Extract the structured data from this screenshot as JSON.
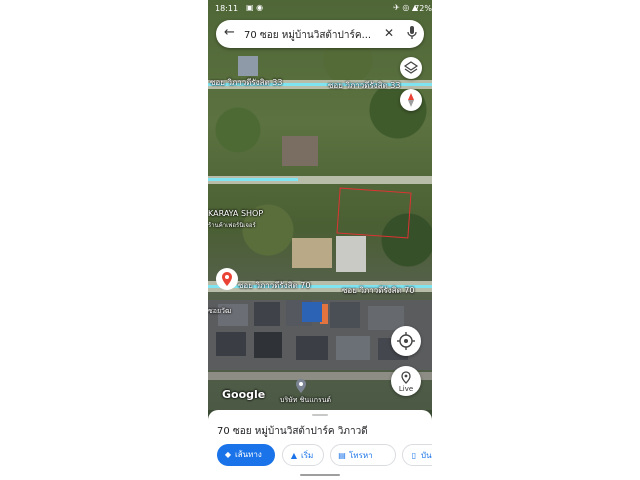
{
  "status_bar": {
    "time": "18:11",
    "battery": "72%"
  },
  "search": {
    "query": "70 ซอย หมู่บ้านวิสต้าปาร์ค..."
  },
  "map": {
    "road_top_label_left": "ซอย วิภาวดีรังสิต 33",
    "road_top_label_right": "ซอย วิภาวดีรังสิต 33",
    "road_mid_label_left": "ซอย วิภาวดีรังสิต 70",
    "road_mid_label_right": "ซอย วิภาวดีรังสิต 70",
    "shop_label": "KARAYA SHOP",
    "shop_sublabel": "ร้านค้าเฟอร์นิเจอร์",
    "bottom_label": "บริษัท ชินแกรนด์",
    "side_label": "ซอยวัฒ",
    "google_logo": "Google"
  },
  "buttons": {
    "live_label": "Live"
  },
  "sheet": {
    "place_title": "70 ซอย หมู่บ้านวิสต้าปาร์ค วิภาวดี",
    "directions_label": "เส้นทาง",
    "start_label": "เริ่ม",
    "call_label": "โทรหา",
    "save_label": "บัน"
  },
  "colors": {
    "accent": "#1a73e8",
    "route_highlight": "#7fe3f0",
    "pin": "#ea4335"
  }
}
